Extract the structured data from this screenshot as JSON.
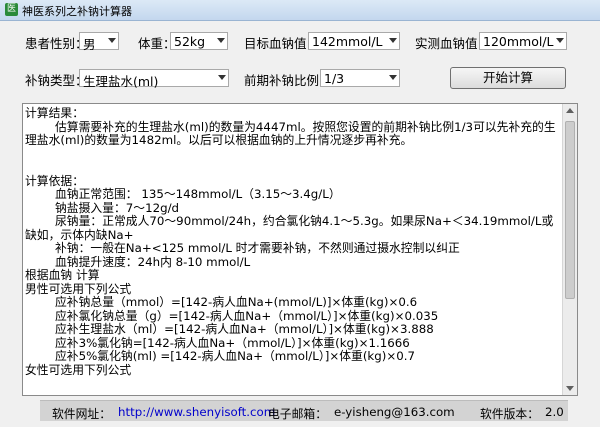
{
  "window": {
    "title": "神医系列之补钠计算器",
    "icon_glyph": "医"
  },
  "form": {
    "gender_label": "患者性别：",
    "gender_value": "男",
    "weight_label": "体重：",
    "weight_value": "52kg",
    "target_label": "目标血钠值：",
    "target_value": "142mmol/L",
    "measured_label": "实测血钠值：",
    "measured_value": "120mmol/L",
    "type_label": "补钠类型：",
    "type_value": "生理盐水(ml)",
    "ratio_label": "前期补钠比例：",
    "ratio_value": "1/3",
    "calc_button": "开始计算"
  },
  "result": {
    "lines": [
      "计算结果：",
      "        估算需要补充的生理盐水(ml)的数量为4447ml。按照您设置的前期补钠比例1/3可以先补充的生理盐水(ml)的数量为1482ml。以后可以根据血钠的上升情况逐步再补充。",
      "",
      "",
      "计算依据：",
      "        血钠正常范围： 135～148mmol/L（3.15～3.4g/L）",
      "        钠盐摄入量：7～12g/d",
      "        尿钠量：正常成人70～90mmol/24h，约合氯化钠4.1～5.3g。如果尿Na+＜34.19mmol/L或缺如，示体内缺Na+",
      "        补钠：一般在Na+<125 mmol/L 时才需要补钠，不然则通过摄水控制以纠正",
      "        血钠提升速度：24h内 8-10 mmol/L",
      "根据血钠 计算",
      "男性可选用下列公式",
      "        应补钠总量（mmol）=[142-病人血Na+(mmol/L)]×体重(kg)×0.6",
      "        应补氯化钠总量（g）=[142-病人血Na+（mmol/L）]×体重(kg)×0.035",
      "        应补生理盐水（ml）=[142-病人血Na+（mmol/L）]×体重(kg)×3.888",
      "        应补3%氯化钠=[142-病人血Na+（mmol/L）]×体重(kg)×1.1666",
      "        应补5%氯化钠(ml) =[142-病人血Na+（mmol/L）]×体重(kg)×0.7",
      "女性可选用下列公式"
    ]
  },
  "status": {
    "website_label": "软件网址：",
    "website_url": "http://www.shenyisoft.com",
    "email_label": "电子邮箱：",
    "email_value": "e-yisheng@163.com",
    "version_label": "软件版本：",
    "version_value": "2.0"
  },
  "colors": {
    "link": "#0000cc",
    "statusbar": "#d3d3d3",
    "app_icon": "#2a8a3a"
  }
}
